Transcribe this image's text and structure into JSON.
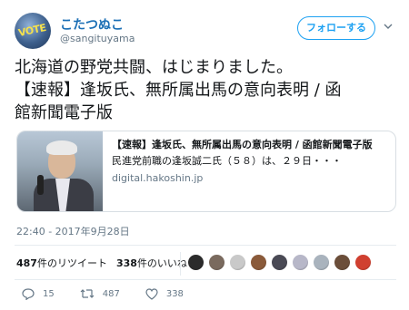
{
  "user": {
    "display_name": "こたつぬこ",
    "handle": "@sangituyama",
    "avatar_text": "VOTE"
  },
  "follow_button_label": "フォローする",
  "tweet": {
    "text_line1": "北海道の野党共闘、はじまりました。",
    "text_line2": "【速報】逢坂氏、無所属出馬の意向表明 / 函",
    "text_line3": "館新聞電子版"
  },
  "card": {
    "title": "【速報】逢坂氏、無所属出馬の意向表明 / 函館新聞電子版",
    "description": "民進党前職の逢坂誠二氏（５８）は、２９日・・・",
    "domain": "digital.hakoshin.jp"
  },
  "timestamp": "22:40 - 2017年9月28日",
  "stats": {
    "retweets_count": "487",
    "retweets_label": "件のリツイート",
    "likes_count": "338",
    "likes_label": "件のいいね"
  },
  "liker_avatar_colors": [
    "#2b2b2b",
    "#7a6a5e",
    "#c9c9c9",
    "#8a5a3a",
    "#4a4a55",
    "#b7b7c8",
    "#a9b3bd",
    "#6b4e3a",
    "#d04030"
  ],
  "actions": {
    "reply_count": "15",
    "retweet_count": "487",
    "like_count": "338"
  },
  "colors": {
    "accent": "#1da1f2",
    "name": "#1b6fb5",
    "muted": "#657786"
  }
}
